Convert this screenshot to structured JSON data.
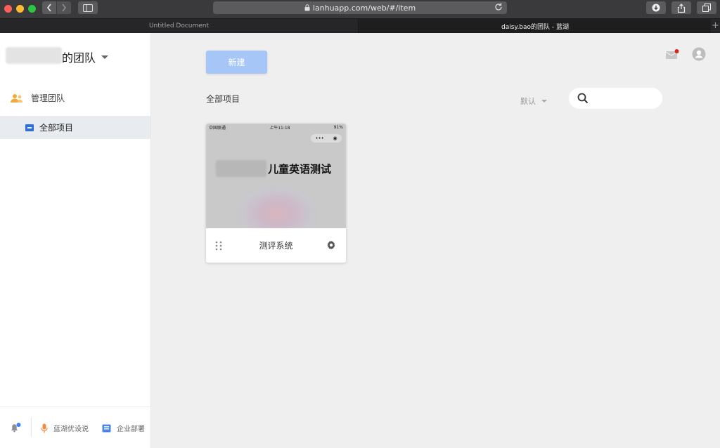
{
  "browser": {
    "url": "lanhuapp.com/web/#/item",
    "tabs": [
      {
        "title": "Untitled Document"
      },
      {
        "title": "daisy.bao的团队 - 蓝湖"
      }
    ]
  },
  "sidebar": {
    "team_name": "的团队",
    "nav": [
      {
        "label": "管理团队",
        "icon": "team-icon"
      },
      {
        "label": "全部项目",
        "icon": "project-icon"
      }
    ],
    "footer": {
      "feedback_label": "蓝湖优设说",
      "deploy_label": "企业部署"
    }
  },
  "main": {
    "new_button_label": "新建",
    "section_title": "全部项目",
    "sort_label": "默认",
    "search_placeholder": "",
    "projects": [
      {
        "name": "测评系统",
        "thumbnail": {
          "carrier": "中国联通",
          "time": "上午11:18",
          "battery": "91%",
          "title": "儿童英语测试"
        }
      }
    ]
  },
  "colors": {
    "accent": "#a7c6f8",
    "active_nav_bg": "#e8ebf0",
    "project_icon": "#2e6fe0",
    "notification_dot": "#e0201b"
  }
}
